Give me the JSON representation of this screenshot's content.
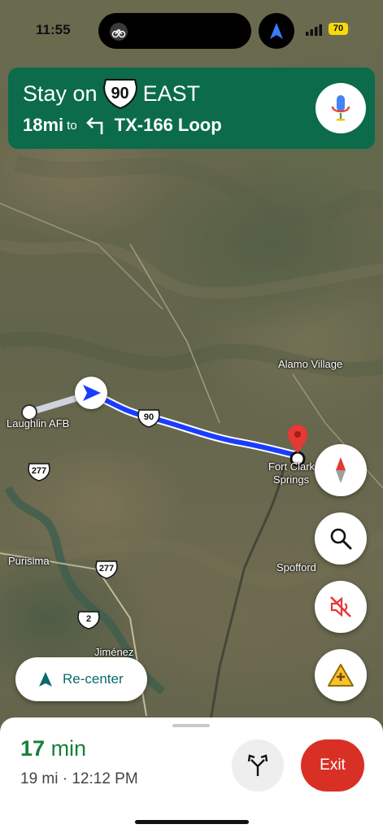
{
  "status_bar": {
    "time": "11:55",
    "battery": "70",
    "island_icon": "bike-icon",
    "nav_icon": "navigation-arrow-icon"
  },
  "instruction": {
    "action": "Stay on",
    "route_shield": "90",
    "direction": "EAST",
    "distance": "18mi",
    "to_word": "to",
    "next_road": "TX-166 Loop",
    "turn_icon": "turn-left-arrow-icon",
    "mic_icon": "microphone-icon"
  },
  "map": {
    "labels": {
      "laughlin": "Laughlin AFB",
      "alamo": "Alamo Village",
      "fort_line1": "Fort Clark",
      "fort_line2": "Springs",
      "spofford": "Spofford",
      "purisima": "Purisima",
      "jimenez": "Jiménez"
    },
    "shields": {
      "us90": "90",
      "us277_a": "277",
      "us277_b": "277",
      "mx2": "2"
    },
    "route_color": "#1a3cff",
    "colors": {
      "banner": "#0b6b4b",
      "eta": "#188038",
      "exit": "#d93025",
      "pin": "#e53935"
    }
  },
  "controls": {
    "compass_icon": "compass-icon",
    "search_icon": "search-icon",
    "mute_icon": "sound-muted-icon",
    "report_icon": "add-report-icon",
    "recenter_label": "Re-center"
  },
  "trip": {
    "eta_number": "17",
    "eta_unit": "min",
    "distance": "19 mi",
    "separator": "·",
    "arrival": "12:12 PM",
    "exit_label": "Exit",
    "routes_icon": "alternate-routes-icon"
  }
}
